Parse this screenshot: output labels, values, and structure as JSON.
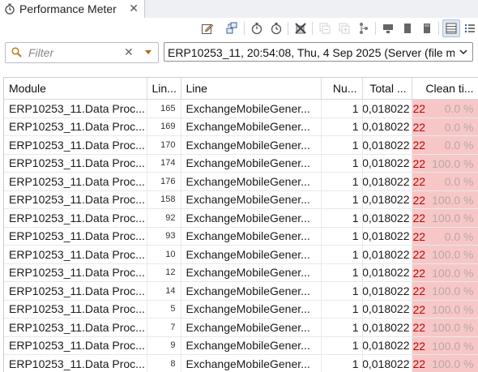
{
  "tab": {
    "title": "Performance Meter"
  },
  "toolbar": {
    "icons": [
      "edit-icon",
      "copy-settings-icon",
      "stopwatch-icon",
      "stopwatch-clock-icon",
      "clear-icon",
      "collapse-icon",
      "expand-icon",
      "tree-icon",
      "server-icon",
      "column-icon",
      "column-alt-icon",
      "table-view-icon",
      "list-view-icon"
    ]
  },
  "filter": {
    "placeholder": "Filter",
    "value": ""
  },
  "session": {
    "selected": "ERP10253_11, 20:54:08, Thu, 4 Sep 2025 (Server (file m"
  },
  "table": {
    "columns": {
      "module": "Module",
      "line_number": "Lin...",
      "line": "Line",
      "count": "Nu...",
      "total": "Total ...",
      "clean": "Clean ti..."
    },
    "rows": [
      {
        "module": "ERP10253_11.Data Proc...",
        "line_number": "165",
        "line": "ExchangeMobileGener...",
        "count": "1",
        "total": "0,018022",
        "clean_abs": "22",
        "clean_pct": "0.0 %"
      },
      {
        "module": "ERP10253_11.Data Proc...",
        "line_number": "169",
        "line": "ExchangeMobileGener...",
        "count": "1",
        "total": "0,018022",
        "clean_abs": "22",
        "clean_pct": "0.0 %"
      },
      {
        "module": "ERP10253_11.Data Proc...",
        "line_number": "170",
        "line": "ExchangeMobileGener...",
        "count": "1",
        "total": "0,018022",
        "clean_abs": "22",
        "clean_pct": "0.0 %"
      },
      {
        "module": "ERP10253_11.Data Proc...",
        "line_number": "174",
        "line": "ExchangeMobileGener...",
        "count": "1",
        "total": "0,018022",
        "clean_abs": "22",
        "clean_pct": "100.0 %"
      },
      {
        "module": "ERP10253_11.Data Proc...",
        "line_number": "176",
        "line": "ExchangeMobileGener...",
        "count": "1",
        "total": "0,018022",
        "clean_abs": "22",
        "clean_pct": "0.0 %"
      },
      {
        "module": "ERP10253_11.Data Proc...",
        "line_number": "158",
        "line": "ExchangeMobileGener...",
        "count": "1",
        "total": "0,018022",
        "clean_abs": "22",
        "clean_pct": "100.0 %"
      },
      {
        "module": "ERP10253_11.Data Proc...",
        "line_number": "92",
        "line": "ExchangeMobileGener...",
        "count": "1",
        "total": "0,018022",
        "clean_abs": "22",
        "clean_pct": "100.0 %"
      },
      {
        "module": "ERP10253_11.Data Proc...",
        "line_number": "93",
        "line": "ExchangeMobileGener...",
        "count": "1",
        "total": "0,018022",
        "clean_abs": "22",
        "clean_pct": "0.0 %"
      },
      {
        "module": "ERP10253_11.Data Proc...",
        "line_number": "10",
        "line": "ExchangeMobileGener...",
        "count": "1",
        "total": "0,018022",
        "clean_abs": "22",
        "clean_pct": "100.0 %"
      },
      {
        "module": "ERP10253_11.Data Proc...",
        "line_number": "12",
        "line": "ExchangeMobileGener...",
        "count": "1",
        "total": "0,018022",
        "clean_abs": "22",
        "clean_pct": "100.0 %"
      },
      {
        "module": "ERP10253_11.Data Proc...",
        "line_number": "14",
        "line": "ExchangeMobileGener...",
        "count": "1",
        "total": "0,018022",
        "clean_abs": "22",
        "clean_pct": "100.0 %"
      },
      {
        "module": "ERP10253_11.Data Proc...",
        "line_number": "5",
        "line": "ExchangeMobileGener...",
        "count": "1",
        "total": "0,018022",
        "clean_abs": "22",
        "clean_pct": "100.0 %"
      },
      {
        "module": "ERP10253_11.Data Proc...",
        "line_number": "7",
        "line": "ExchangeMobileGener...",
        "count": "1",
        "total": "0,018022",
        "clean_abs": "22",
        "clean_pct": "100.0 %"
      },
      {
        "module": "ERP10253_11.Data Proc...",
        "line_number": "9",
        "line": "ExchangeMobileGener...",
        "count": "1",
        "total": "0,018022",
        "clean_abs": "22",
        "clean_pct": "100.0 %"
      },
      {
        "module": "ERP10253_11.Data Proc...",
        "line_number": "8",
        "line": "ExchangeMobileGener...",
        "count": "1",
        "total": "0,018022",
        "clean_abs": "22",
        "clean_pct": "100.0 %"
      }
    ]
  }
}
